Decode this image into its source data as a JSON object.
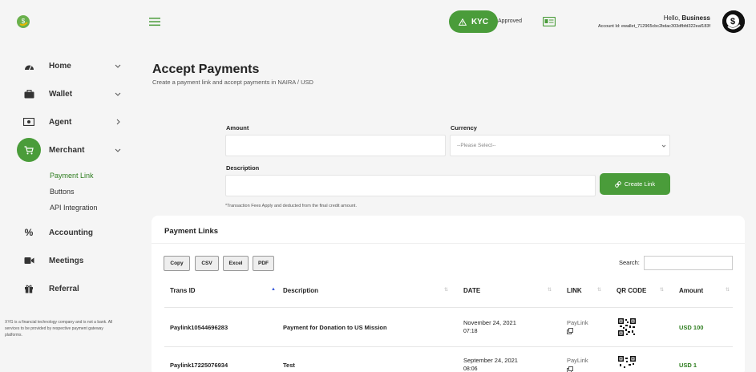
{
  "sidebar": {
    "items": [
      {
        "label": "Home",
        "icon": "dashboard-icon"
      },
      {
        "label": "Wallet",
        "icon": "briefcase-icon"
      },
      {
        "label": "Agent",
        "icon": "cash-icon"
      },
      {
        "label": "Merchant",
        "icon": "cart-icon"
      },
      {
        "label": "Accounting",
        "icon": "percent-icon"
      },
      {
        "label": "Meetings",
        "icon": "video-icon"
      },
      {
        "label": "Referral",
        "icon": "gift-icon"
      }
    ],
    "merchant_sub": [
      "Payment Link",
      "Buttons",
      "API Integration"
    ],
    "disclaimer": "XYG is a financial technology company and is not a bank. All services to be provided by respective payment gateway platforms."
  },
  "header": {
    "kyc_label": "KYC",
    "kyc_status": "Approved",
    "greeting": "Hello, ",
    "user_name": "Business",
    "account_id": "Account Id: ewallet_712965cbc2bdac303dfbfd322eaf183f"
  },
  "page": {
    "title": "Accept Payments",
    "subtitle": "Create a payment link and accept payments in NAIRA / USD"
  },
  "form": {
    "amount_label": "Amount",
    "currency_label": "Currency",
    "currency_placeholder": "--Please Select--",
    "description_label": "Description",
    "create_button": "Create Link",
    "fee_note": "*Transaction Fees Apply and deducted from the final credit amount."
  },
  "table": {
    "title": "Payment Links",
    "export_buttons": [
      "Copy",
      "CSV",
      "Excel",
      "PDF"
    ],
    "search_label": "Search:",
    "columns": [
      "Trans ID",
      "Description",
      "DATE",
      "LINK",
      "QR CODE",
      "Amount"
    ],
    "rows": [
      {
        "trans_id": "Paylink10544696283",
        "description": "Payment for Donation to US Mission",
        "date": "November 24, 2021",
        "time": "07:18",
        "link": "PayLink",
        "amount": "USD 100"
      },
      {
        "trans_id": "Paylink17225076934",
        "description": "Test",
        "date": "September 24, 2021",
        "time": "08:06",
        "link": "PayLink",
        "amount": "USD 1"
      }
    ]
  },
  "colors": {
    "accent": "#4a9c3a",
    "amount_text": "#2e7d1f"
  }
}
